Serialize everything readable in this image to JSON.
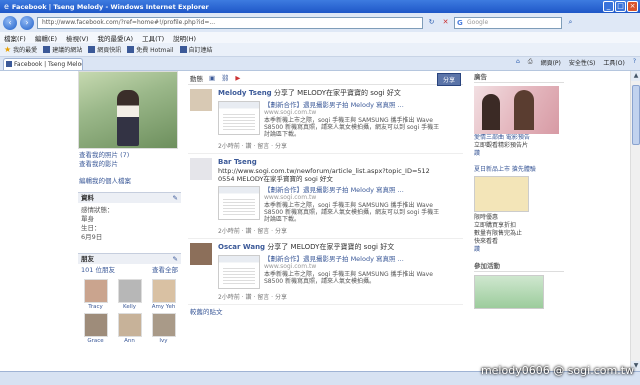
{
  "window": {
    "title": "Facebook | Tseng Melody - Windows Internet Explorer"
  },
  "address": {
    "url": "http://www.facebook.com/?ref=home#!/profile.php?id=...",
    "search_placeholder": "Google"
  },
  "menubar": [
    "檔案(F)",
    "編輯(E)",
    "檢視(V)",
    "我的最愛(A)",
    "工具(T)",
    "說明(H)"
  ],
  "favorites": {
    "label": "我的最愛",
    "items": [
      "建議的網站",
      "網頁快訊",
      "免費 Hotmail",
      "自訂連結"
    ]
  },
  "tab": {
    "label": "Facebook | Tseng Melody"
  },
  "commandbar": [
    "網頁(P)",
    "安全性(S)",
    "工具(O)"
  ],
  "profile": {
    "line1": "查看我的照片 (7)",
    "line2": "查看我的影片",
    "edit_link": "編輯我的個人檔案",
    "info_title": "資料",
    "info_lines": [
      "感情狀態：",
      "單身",
      "生日：",
      "6月9日"
    ],
    "friends_title": "朋友",
    "friends_count": "101 位朋友",
    "friends_see_all": "查看全部",
    "friends": [
      "Tracy",
      "Kelly",
      "Amy Yeh",
      "Grace",
      "Ann",
      "Ivy"
    ]
  },
  "feed": {
    "tabs": [
      "動態",
      "相片",
      "連結",
      "影片"
    ],
    "share_button": "分享",
    "stories": [
      {
        "author": "Melody Tseng",
        "text": "分享了 MELODY在家乎寶寶的 sogi 好文",
        "att_title": "【劃新合作】遇見攝影男子拍 Melody 寫真照 ...",
        "att_url": "www.sogi.com.tw",
        "att_desc": "本季新機上市之際，sogi 手機王與 SAMSUNG 攜手推出 Wave S8500 新機寫真照，請來人氣女模拍攝，網友可以到 sogi 手機王討論區下載。",
        "meta": "2小時前 · 讚 · 留言 · 分享"
      },
      {
        "author": "Bar Tseng",
        "text": "http://www.sogi.com.tw/newforum/article_list.aspx?topic_ID=5120554 MELODY在家乎寶寶的 sogi 好文",
        "att_title": "【劃新合作】遇見攝影男子拍 Melody 寫真照 ...",
        "att_url": "www.sogi.com.tw",
        "att_desc": "本季新機上市之際，sogi 手機王與 SAMSUNG 攜手推出 Wave S8500 新機寫真照，請來人氣女模拍攝，網友可以到 sogi 手機王討論區下載。",
        "meta": "2小時前 · 讚 · 留言 · 分享"
      },
      {
        "author": "Oscar Wang",
        "text": "分享了 MELODY在家乎寶寶的 sogi 好文",
        "att_title": "【劃新合作】遇見攝影男子拍 Melody 寫真照 ...",
        "att_url": "www.sogi.com.tw",
        "att_desc": "本季新機上市之際，sogi 手機王與 SAMSUNG 攜手推出 Wave S8500 新機寫真照，請來人氣女模拍攝。",
        "meta": "2小時前 · 讚 · 留言 · 分享"
      }
    ],
    "more": "較舊的貼文"
  },
  "right": {
    "ads_title": "廣告",
    "ad1_title": "愛情三部曲 電影預告",
    "ad1_text": "立即觀看精彩預告片",
    "ad1_link": "讚",
    "ad2_title": "夏日新品上市 搶先體驗",
    "ad2_lines": [
      "限時優惠",
      "立即購買享折扣",
      "數量有限售完為止",
      "快來看看"
    ],
    "ad2_link": "讚",
    "ad3_title": "參加活動"
  },
  "watermark": "melody0606 @ sogi.com.tw",
  "colors": {
    "facebook_blue": "#3b5998",
    "titlebar_blue": "#1f57c7"
  }
}
